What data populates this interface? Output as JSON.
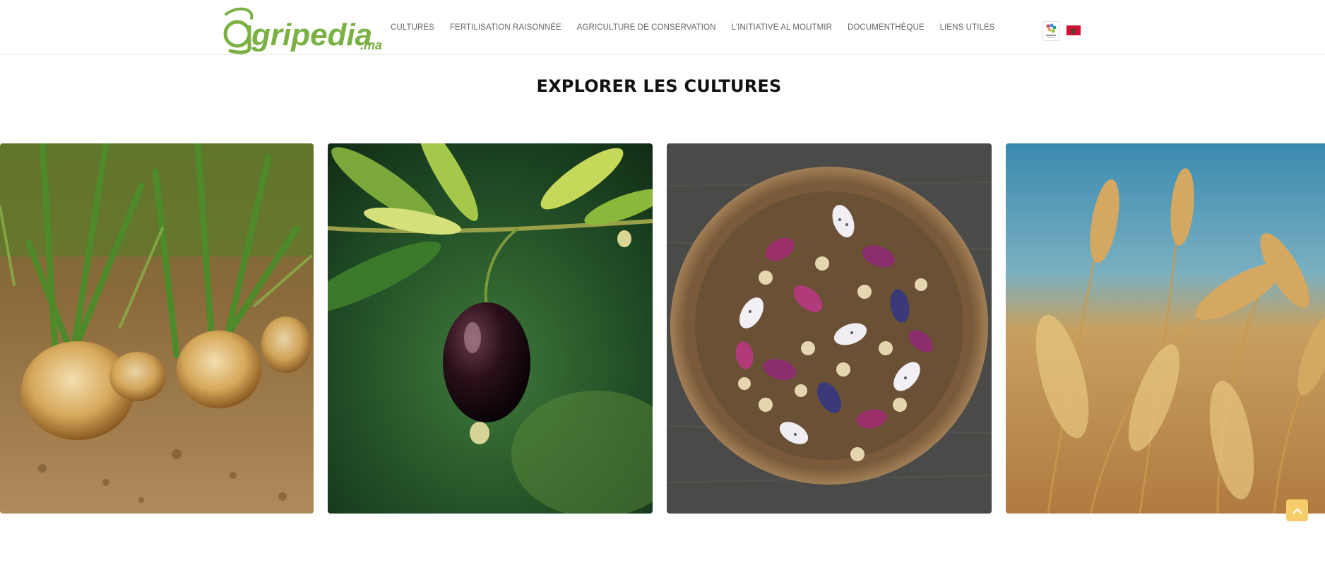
{
  "brand": {
    "name": "gripedia",
    "suffix": ".ma",
    "color": "#7bb043"
  },
  "nav": {
    "items": [
      {
        "label": "CULTURES"
      },
      {
        "label": "FERTILISATION RAISONNÉE"
      },
      {
        "label": "AGRICULTURE DE CONSERVATION"
      },
      {
        "label": "L'INITIATIVE AL MOUTMIR"
      },
      {
        "label": "DOCUMENTHÈQUE"
      },
      {
        "label": "LIENS UTILES"
      }
    ]
  },
  "language": {
    "flag": "morocco-flag-icon",
    "flag_color": "#d21034"
  },
  "main": {
    "title": "EXPLORER LES CULTURES"
  },
  "cards": [
    {
      "image": "onion-field-photo"
    },
    {
      "image": "olive-branch-photo"
    },
    {
      "image": "beans-bowl-photo"
    },
    {
      "image": "wheat-field-photo"
    }
  ],
  "scroll_top": {
    "icon": "chevron-up-icon",
    "color": "#f5cd6b"
  }
}
